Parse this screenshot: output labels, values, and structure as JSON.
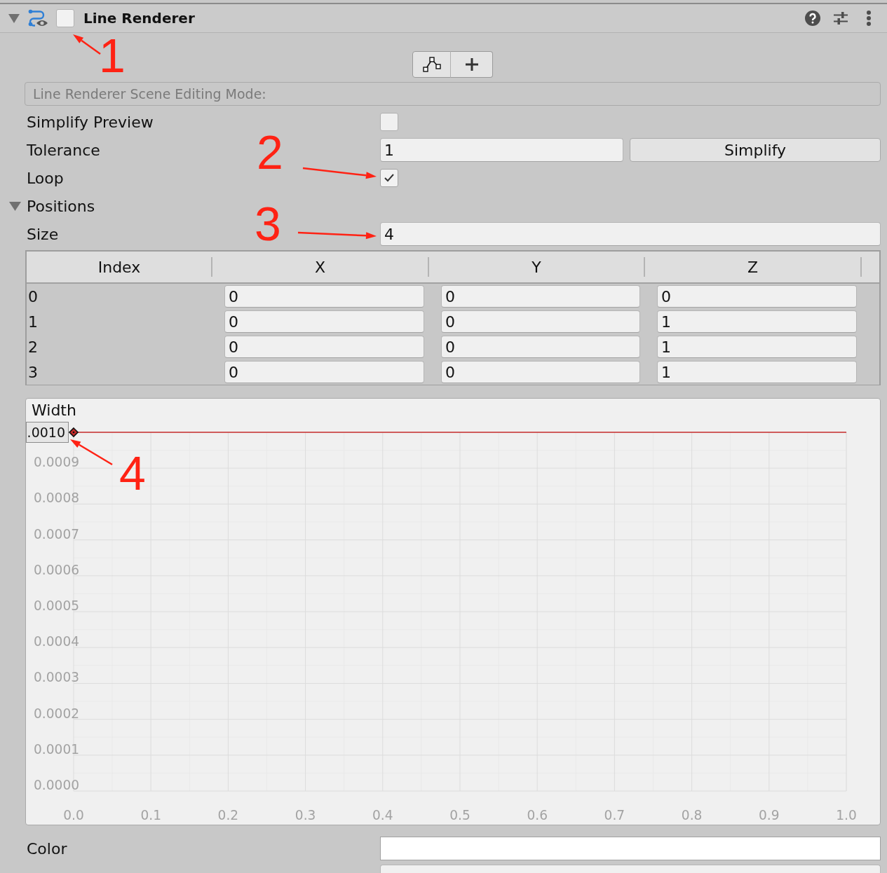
{
  "component": {
    "title": "Line Renderer",
    "expanded": true,
    "enabled": false,
    "callout": "1"
  },
  "scene_editing_mode": {
    "label": "Line Renderer Scene Editing Mode:"
  },
  "fields": [
    {
      "kind": "checkbox",
      "label": "Simplify Preview",
      "checked": false
    },
    {
      "kind": "number_with_button",
      "label": "Tolerance",
      "value": "1",
      "button": "Simplify"
    },
    {
      "kind": "checkbox",
      "label": "Loop",
      "checked": true,
      "callout": "2"
    }
  ],
  "positions": {
    "label": "Positions",
    "expanded": true,
    "size": {
      "label": "Size",
      "value": "4",
      "callout": "3"
    },
    "table": {
      "columns": [
        "Index",
        "X",
        "Y",
        "Z"
      ],
      "rows": [
        [
          "0",
          "0",
          "0",
          "0"
        ],
        [
          "1",
          "0",
          "0",
          "1"
        ],
        [
          "2",
          "0",
          "0",
          "1"
        ],
        [
          "3",
          "0",
          "0",
          "1"
        ]
      ]
    }
  },
  "width_curve": {
    "key_value": ".0010",
    "callout": "4",
    "chart_data": {
      "type": "line",
      "x": [
        0
      ],
      "series": [
        {
          "name": "Width",
          "color": "#c42a2a",
          "marker": "diamond",
          "values": [
            0.001
          ]
        }
      ],
      "xlim": [
        0,
        1
      ],
      "ylim": [
        0,
        0.001
      ],
      "grid": true,
      "xticks": [
        {
          "value": 0,
          "label": "0.0"
        },
        {
          "value": 0.1,
          "label": "0.1"
        },
        {
          "value": 0.2,
          "label": "0.2"
        },
        {
          "value": 0.3,
          "label": "0.3"
        },
        {
          "value": 0.4,
          "label": "0.4"
        },
        {
          "value": 0.5,
          "label": "0.5"
        },
        {
          "value": 0.6,
          "label": "0.6"
        },
        {
          "value": 0.7,
          "label": "0.7"
        },
        {
          "value": 0.8,
          "label": "0.8"
        },
        {
          "value": 0.9,
          "label": "0.9"
        },
        {
          "value": 1,
          "label": "1.0"
        }
      ],
      "yticks": [
        {
          "value": 0,
          "label": "0.0000"
        },
        {
          "value": 0.0001,
          "label": "0.0001"
        },
        {
          "value": 0.0002,
          "label": "0.0002"
        },
        {
          "value": 0.0003,
          "label": "0.0003"
        },
        {
          "value": 0.0004,
          "label": "0.0004"
        },
        {
          "value": 0.0005,
          "label": "0.0005"
        },
        {
          "value": 0.0006,
          "label": "0.0006"
        },
        {
          "value": 0.0007,
          "label": "0.0007"
        },
        {
          "value": 0.0008,
          "label": "0.0008"
        },
        {
          "value": 0.0009,
          "label": "0.0009"
        }
      ]
    }
  },
  "color": {
    "label": "Color",
    "color": "#ffffff"
  },
  "cut_off_field_below": true
}
